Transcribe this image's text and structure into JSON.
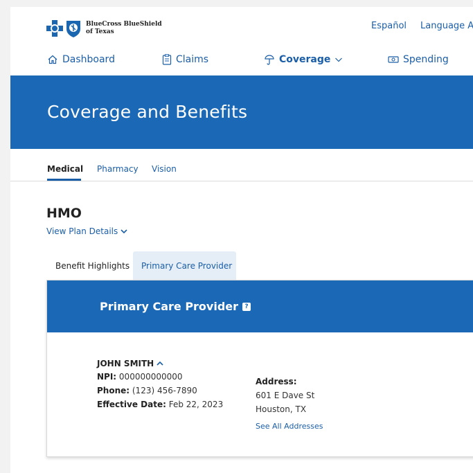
{
  "header": {
    "logo_line1": "BlueCross BlueShield",
    "logo_line2": "of Texas",
    "util_links": [
      "Español",
      "Language A"
    ]
  },
  "nav": {
    "dashboard": "Dashboard",
    "claims": "Claims",
    "coverage": "Coverage",
    "spending": "Spending"
  },
  "hero": {
    "title": "Coverage and Benefits"
  },
  "subtabs": [
    "Medical",
    "Pharmacy",
    "Vision"
  ],
  "plan": {
    "type": "HMO",
    "details_link": "View Plan Details"
  },
  "card_tabs": [
    "Benefit Highlights",
    "Primary Care Provider"
  ],
  "card": {
    "title": "Primary Care Provider",
    "help_icon_text": "?",
    "provider_name": "JOHN SMITH",
    "npi_label": "NPI:",
    "npi_value": " 000000000000",
    "phone_label": "Phone:",
    "phone_value": " (123) 456-7890",
    "effective_label": "Effective Date:",
    "effective_value": " Feb 22, 2023",
    "address_label": "Address:",
    "address_line1": "601 E  Dave  St",
    "address_line2": "Houston, TX",
    "see_all": "See All Addresses"
  },
  "colors": {
    "brand_blue": "#1b69b6",
    "link_blue": "#1a5ea8",
    "tab_bg": "#e5eef7"
  }
}
